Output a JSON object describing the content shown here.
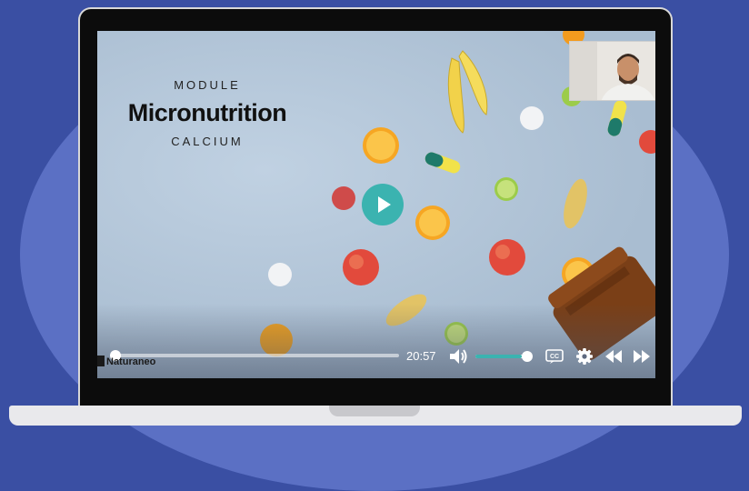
{
  "course": {
    "module_label": "MODULE",
    "title": "Micronutrition",
    "subtitle": "CALCIUM"
  },
  "player": {
    "time": "20:57",
    "progress": 0.02,
    "volume": 0.85,
    "accent_color": "#3bb3b0",
    "brand": "Naturaneo"
  },
  "icons": {
    "play": "play-icon",
    "volume": "volume-icon",
    "captions": "cc-icon",
    "settings": "gear-icon",
    "rewind": "rewind-icon",
    "forward": "fast-forward-icon"
  }
}
